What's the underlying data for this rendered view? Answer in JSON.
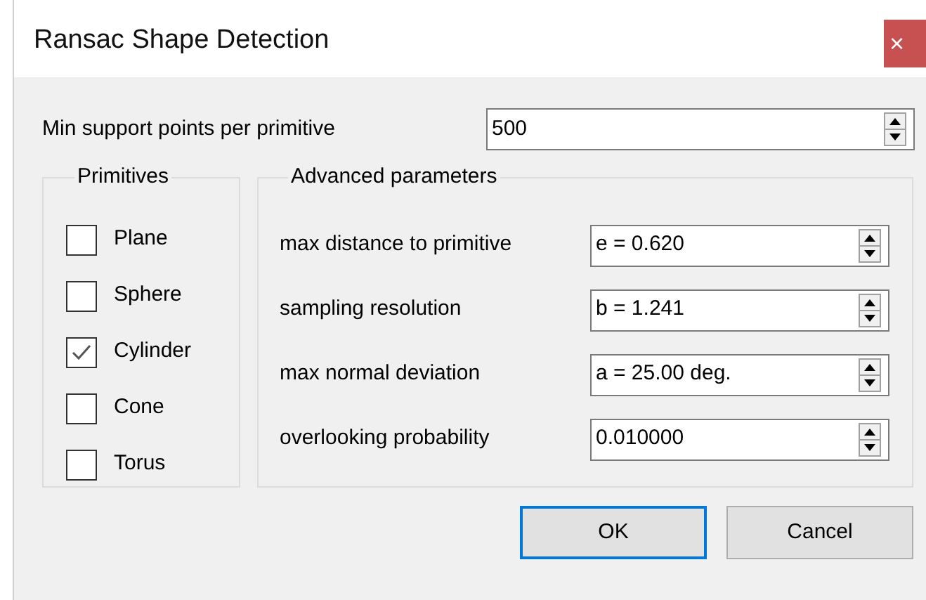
{
  "window": {
    "title": "Ransac Shape Detection",
    "close": "×"
  },
  "min_support": {
    "label": "Min support points per primitive",
    "value": "500"
  },
  "primitives": {
    "title": "Primitives",
    "items": [
      {
        "label": "Plane",
        "checked": false
      },
      {
        "label": "Sphere",
        "checked": false
      },
      {
        "label": "Cylinder",
        "checked": true
      },
      {
        "label": "Cone",
        "checked": false
      },
      {
        "label": "Torus",
        "checked": false
      }
    ]
  },
  "advanced": {
    "title": "Advanced parameters",
    "rows": [
      {
        "label": "max distance to primitive",
        "value": "e = 0.620"
      },
      {
        "label": "sampling resolution",
        "value": "b = 1.241"
      },
      {
        "label": "max normal deviation",
        "value": "a = 25.00 deg."
      },
      {
        "label": "overlooking probability",
        "value": "0.010000"
      }
    ]
  },
  "buttons": [
    {
      "label": "OK",
      "default": true
    },
    {
      "label": "Cancel",
      "default": false
    }
  ]
}
